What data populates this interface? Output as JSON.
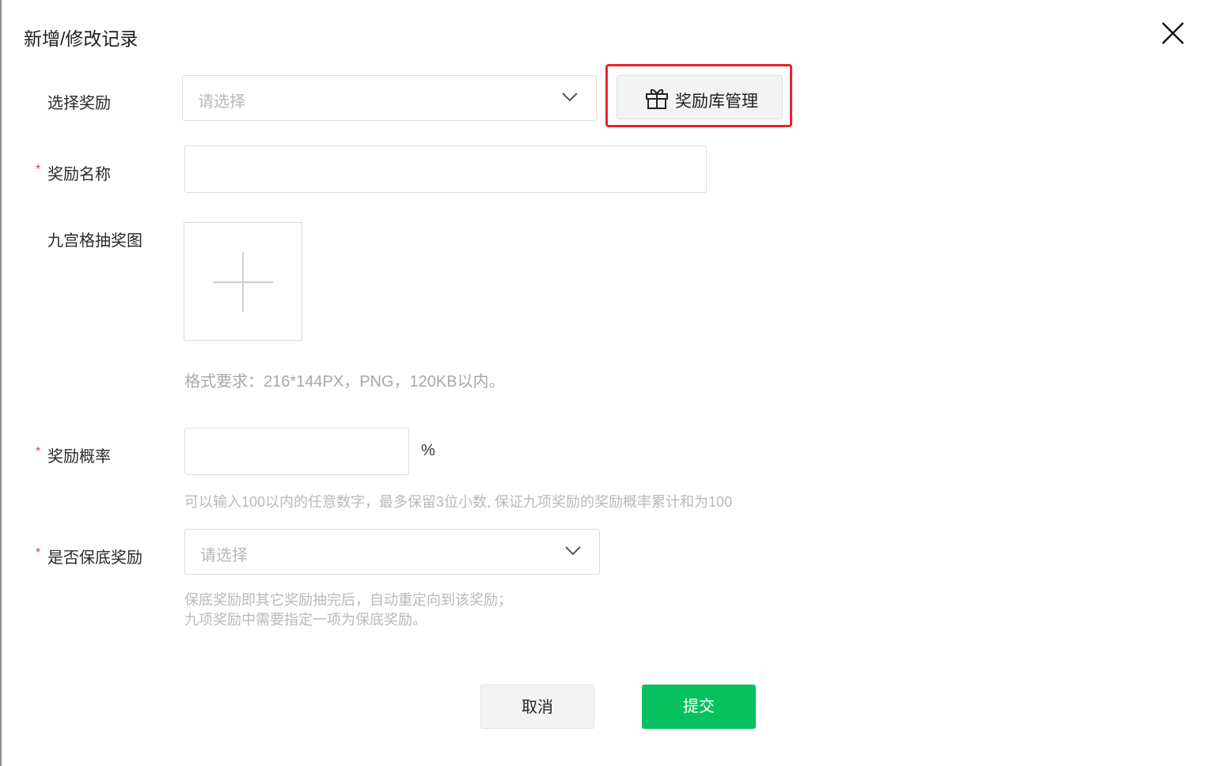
{
  "dialog": {
    "title": "新增/修改记录"
  },
  "fields": {
    "reward_select": {
      "label": "选择奖励",
      "placeholder": "请选择"
    },
    "reward_library_button": {
      "label": "奖励库管理",
      "icon": "gift-icon"
    },
    "reward_name": {
      "label": "奖励名称",
      "required_mark": "*",
      "value": ""
    },
    "grid_image": {
      "label": "九宫格抽奖图",
      "hint": "格式要求：216*144PX，PNG，120KB以内。",
      "icon": "plus-icon"
    },
    "probability": {
      "label": "奖励概率",
      "required_mark": "*",
      "value": "",
      "unit": "%",
      "hint": "可以输入100以内的任意数字，最多保留3位小数, 保证九项奖励的奖励概率累计和为100"
    },
    "fallback": {
      "label": "是否保底奖励",
      "required_mark": "*",
      "placeholder": "请选择",
      "hint_line1": "保底奖励即其它奖励抽完后，自动重定向到该奖励；",
      "hint_line2": "九项奖励中需要指定一项为保底奖励。"
    }
  },
  "actions": {
    "cancel": "取消",
    "submit": "提交"
  },
  "colors": {
    "primary": "#07c160",
    "required": "#e23c3c",
    "highlight": "#e8262b"
  }
}
